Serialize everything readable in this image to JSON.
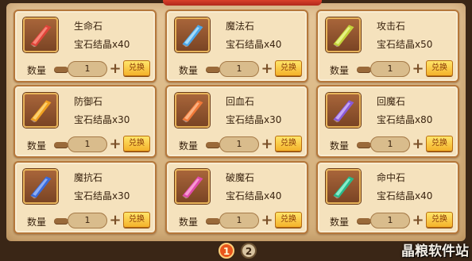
{
  "shop": {
    "qty_label": "数量",
    "exchange_label": "兑换",
    "items": [
      {
        "name": "生命石",
        "cost": "宝石结晶x40",
        "quantity": "1",
        "gem_color": "#e0443a",
        "gem_light": "#ff9c8c",
        "gem_icon": "red-gem-icon"
      },
      {
        "name": "魔法石",
        "cost": "宝石结晶x40",
        "quantity": "1",
        "gem_color": "#4aa6e8",
        "gem_light": "#c4ecff",
        "gem_icon": "blue-gem-icon"
      },
      {
        "name": "攻击石",
        "cost": "宝石结晶x50",
        "quantity": "1",
        "gem_color": "#c4d23a",
        "gem_light": "#f2ff9c",
        "gem_icon": "yellow-green-gem-icon"
      },
      {
        "name": "防御石",
        "cost": "宝石结晶x30",
        "quantity": "1",
        "gem_color": "#f0a020",
        "gem_light": "#ffe08a",
        "gem_icon": "orange-gem-icon"
      },
      {
        "name": "回血石",
        "cost": "宝石结晶x30",
        "quantity": "1",
        "gem_color": "#f07838",
        "gem_light": "#ffc49a",
        "gem_icon": "orange-red-gem-icon"
      },
      {
        "name": "回魔石",
        "cost": "宝石结晶x80",
        "quantity": "1",
        "gem_color": "#8a5ad8",
        "gem_light": "#d8c0ff",
        "gem_icon": "purple-gem-icon"
      },
      {
        "name": "魔抗石",
        "cost": "宝石结晶x30",
        "quantity": "1",
        "gem_color": "#3a6ad8",
        "gem_light": "#a8c4ff",
        "gem_icon": "dark-blue-gem-icon"
      },
      {
        "name": "破魔石",
        "cost": "宝石结晶x40",
        "quantity": "1",
        "gem_color": "#e04aa8",
        "gem_light": "#ffb4e2",
        "gem_icon": "pink-gem-icon"
      },
      {
        "name": "命中石",
        "cost": "宝石结晶x40",
        "quantity": "1",
        "gem_color": "#2ab88a",
        "gem_light": "#a8ffe0",
        "gem_icon": "teal-gem-icon"
      }
    ]
  },
  "pagination": {
    "pages": [
      "1",
      "2"
    ],
    "current": "1"
  },
  "watermark": "晶粮软件站"
}
